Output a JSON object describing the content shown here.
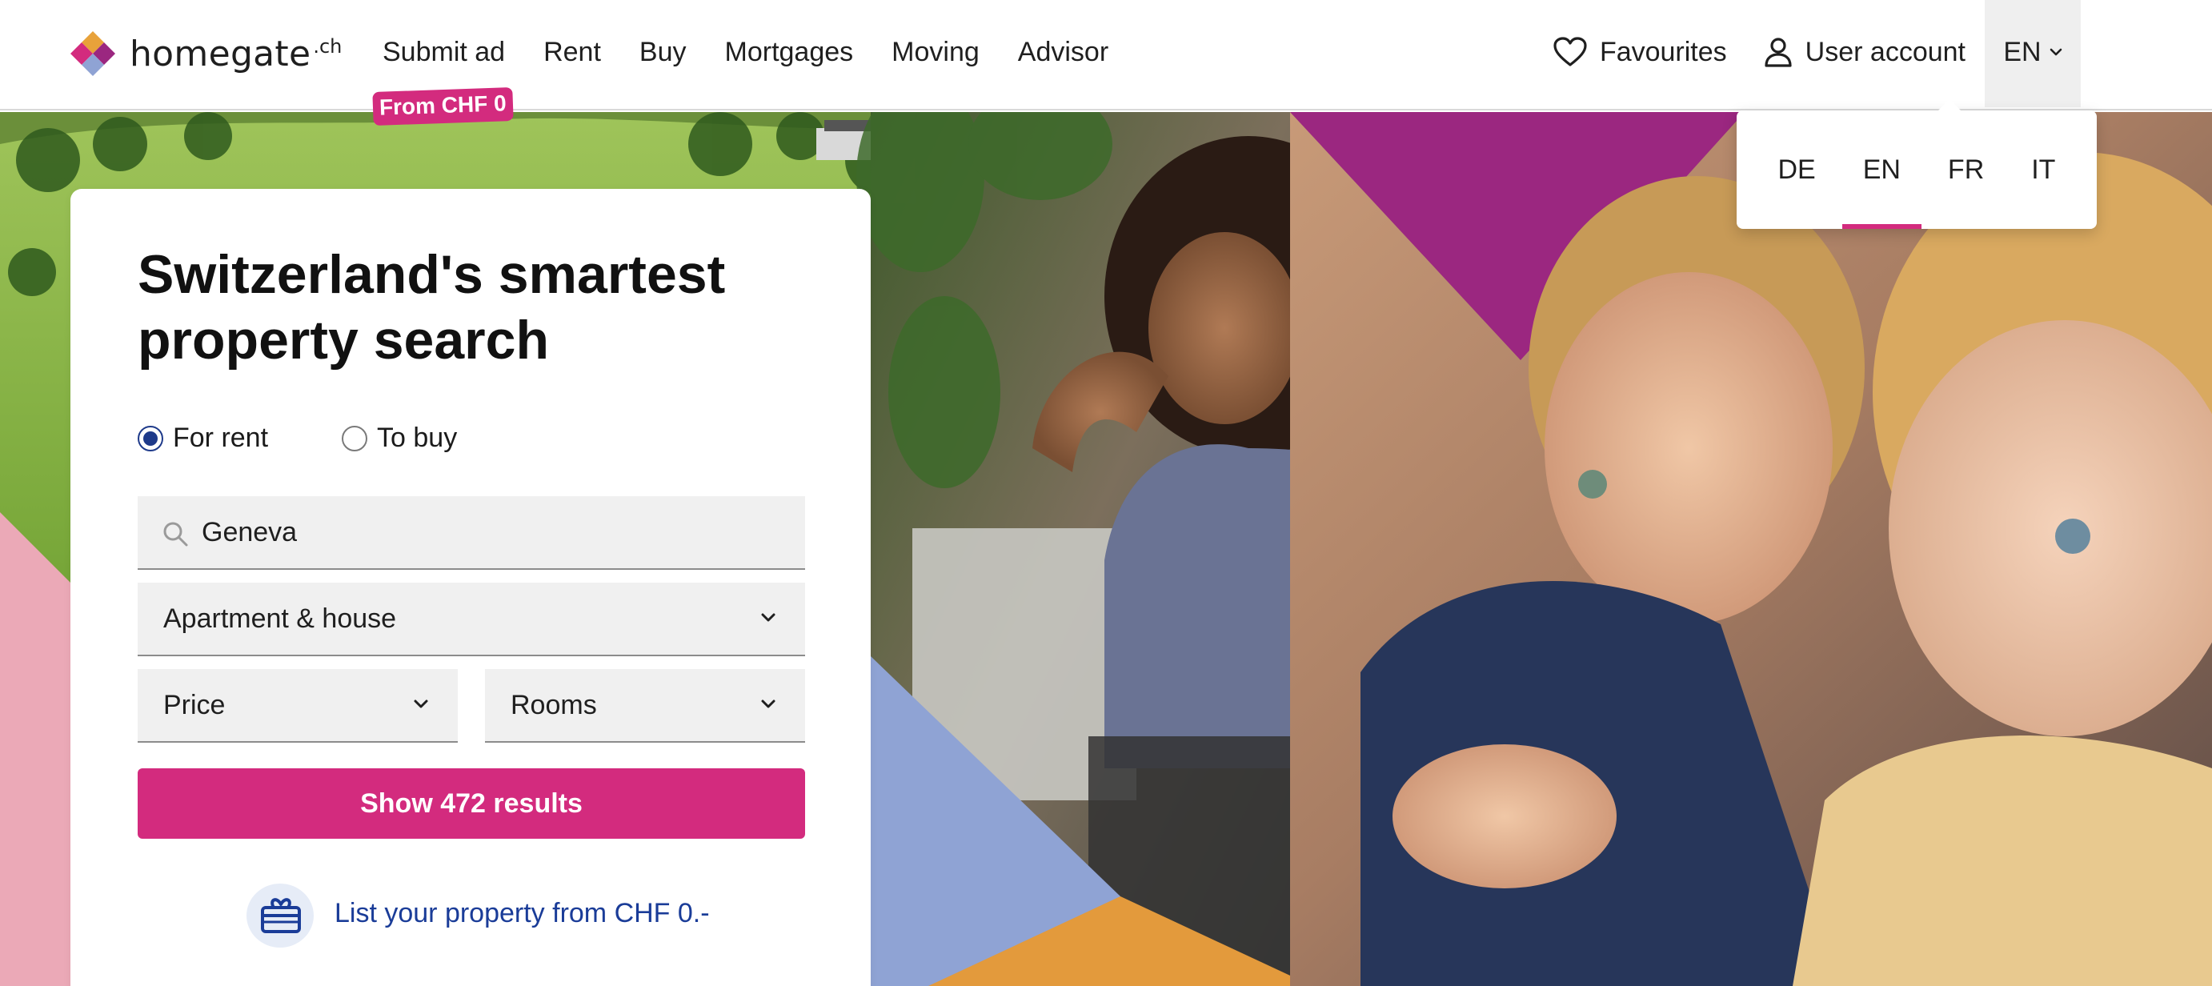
{
  "brand": {
    "name": "homegate",
    "tld": ".ch"
  },
  "nav": {
    "items": [
      {
        "label": "Submit ad",
        "badge": "From CHF 0"
      },
      {
        "label": "Rent"
      },
      {
        "label": "Buy"
      },
      {
        "label": "Mortgages"
      },
      {
        "label": "Moving"
      },
      {
        "label": "Advisor"
      }
    ],
    "favourites": "Favourites",
    "user_account": "User account",
    "language": "EN"
  },
  "language_menu": {
    "options": [
      "DE",
      "EN",
      "FR",
      "IT"
    ],
    "selected": "EN"
  },
  "search": {
    "title": "Switzerland's smartest property search",
    "modes": [
      {
        "label": "For rent",
        "checked": true
      },
      {
        "label": "To buy",
        "checked": false
      }
    ],
    "location_value": "Geneva",
    "property_type": "Apartment & house",
    "price_label": "Price",
    "rooms_label": "Rooms",
    "submit_label": "Show 472 results",
    "list_property": "List your property from CHF 0.-"
  },
  "colors": {
    "brand_pink": "#d32b7e",
    "link_blue": "#1a3c98",
    "radio_blue": "#1e3a8a",
    "hero_purple": "#9b2780",
    "hero_blue": "#8fa3d4",
    "hero_orange": "#e39a3c",
    "hero_rose": "#eba9b7"
  },
  "icons": {
    "logo": "homegate-diamond-logo",
    "favourites": "heart-icon",
    "account": "user-icon",
    "language": "chevron-down-icon",
    "search": "search-icon",
    "dropdown": "chevron-down-icon",
    "list_property": "gift-card-icon"
  }
}
